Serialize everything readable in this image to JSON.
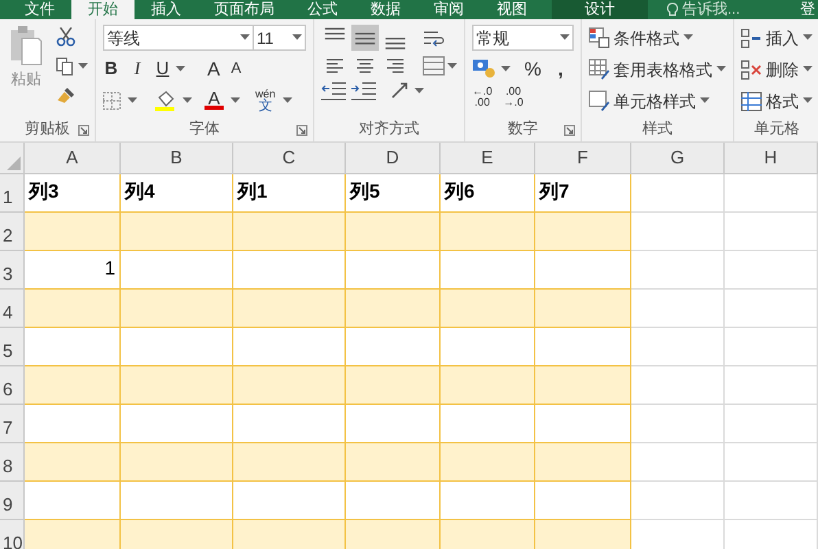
{
  "tabs": [
    {
      "label": "文件",
      "selected": false,
      "kind": "normal"
    },
    {
      "label": "开始",
      "selected": true,
      "kind": "normal"
    },
    {
      "label": "插入",
      "selected": false,
      "kind": "normal"
    },
    {
      "label": "页面布局",
      "selected": false,
      "kind": "normal"
    },
    {
      "label": "公式",
      "selected": false,
      "kind": "normal"
    },
    {
      "label": "数据",
      "selected": false,
      "kind": "normal"
    },
    {
      "label": "审阅",
      "selected": false,
      "kind": "normal"
    },
    {
      "label": "视图",
      "selected": false,
      "kind": "normal"
    },
    {
      "label": "设计",
      "selected": false,
      "kind": "contextual"
    }
  ],
  "tell_me": "告诉我...",
  "account": "登",
  "ribbon": {
    "clipboard": {
      "label": "剪贴板",
      "paste": "粘贴"
    },
    "font": {
      "label": "字体",
      "font_name": "等线",
      "font_size": "11",
      "bold": "B",
      "italic": "I",
      "underline": "U",
      "grow": "A",
      "shrink": "A",
      "font_color": "A",
      "phonetic_top": "wén",
      "phonetic_bottom": "文"
    },
    "alignment": {
      "label": "对齐方式",
      "vertical": [
        {
          "kind": "top",
          "selected": false
        },
        {
          "kind": "middle",
          "selected": true
        },
        {
          "kind": "bottom",
          "selected": false
        }
      ]
    },
    "number": {
      "label": "数字",
      "format": "常规",
      "percent": "%",
      "comma": ",",
      "increase_decimal": [
        "←.0",
        ".00"
      ],
      "decrease_decimal": [
        ".00",
        "→.0"
      ]
    },
    "styles": {
      "label": "样式",
      "items": [
        {
          "kind": "conditional",
          "text": "条件格式"
        },
        {
          "kind": "table",
          "text": "套用表格格式"
        },
        {
          "kind": "cell",
          "text": "单元格样式"
        }
      ]
    },
    "cells": {
      "label": "单元格",
      "items": [
        {
          "kind": "insert",
          "text": "插入"
        },
        {
          "kind": "delete",
          "text": "删除"
        },
        {
          "kind": "format",
          "text": "格式"
        }
      ]
    }
  },
  "sheet": {
    "columns": [
      {
        "label": "A",
        "in_table": true
      },
      {
        "label": "B",
        "in_table": true
      },
      {
        "label": "C",
        "in_table": true
      },
      {
        "label": "D",
        "in_table": true
      },
      {
        "label": "E",
        "in_table": true
      },
      {
        "label": "F",
        "in_table": true
      },
      {
        "label": "G",
        "in_table": false
      },
      {
        "label": "H",
        "in_table": false
      }
    ],
    "rows": [
      {
        "label": "1",
        "kind": "header",
        "cells": [
          {
            "text": "列3",
            "kind": "text"
          },
          {
            "text": "列4",
            "kind": "text"
          },
          {
            "text": "列1",
            "kind": "text"
          },
          {
            "text": "列5",
            "kind": "text"
          },
          {
            "text": "列6",
            "kind": "text"
          },
          {
            "text": "列7",
            "kind": "text"
          }
        ]
      },
      {
        "label": "2",
        "kind": "band"
      },
      {
        "label": "3",
        "kind": "plain",
        "cells": [
          {
            "text": "1",
            "kind": "number"
          }
        ]
      },
      {
        "label": "4",
        "kind": "band"
      },
      {
        "label": "5",
        "kind": "plain"
      },
      {
        "label": "6",
        "kind": "band"
      },
      {
        "label": "7",
        "kind": "plain"
      },
      {
        "label": "8",
        "kind": "band"
      },
      {
        "label": "9",
        "kind": "plain"
      },
      {
        "label": "10",
        "kind": "band"
      }
    ]
  }
}
